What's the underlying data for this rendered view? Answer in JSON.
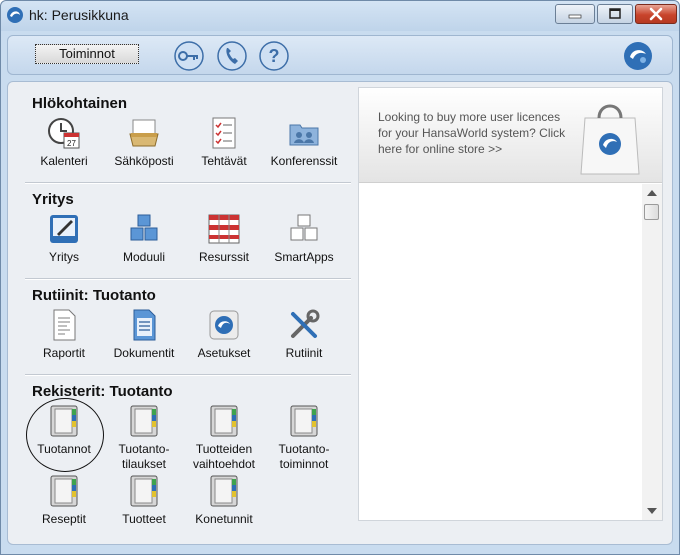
{
  "window": {
    "title": "hk: Perusikkuna"
  },
  "toolbar": {
    "menu_button_label": "Toiminnot",
    "icons": [
      "key-icon",
      "phone-icon",
      "help-icon",
      "globe-icon"
    ]
  },
  "sections": [
    {
      "title": "Hlökohtainen",
      "items": [
        "Kalenteri",
        "Sähköposti",
        "Tehtävät",
        "Konferenssit"
      ]
    },
    {
      "title": "Yritys",
      "items": [
        "Yritys",
        "Moduuli",
        "Resurssit",
        "SmartApps"
      ]
    },
    {
      "title": "Rutiinit: Tuotanto",
      "items": [
        "Raportit",
        "Dokumentit",
        "Asetukset",
        "Rutiinit"
      ]
    },
    {
      "title": "Rekisterit: Tuotanto",
      "items": [
        "Tuotannot",
        "Tuotanto-\ntilaukset",
        "Tuotteiden\nvaihtoehdot",
        "Tuotanto-\ntoiminnot",
        "Reseptit",
        "Tuotteet",
        "Konetunnit"
      ]
    }
  ],
  "ad": {
    "text": "Looking to buy more user licences for your HansaWorld system? Click here for online store >>"
  },
  "colors": {
    "title_bar": "#c9dcef",
    "close_button": "#c8442c",
    "panel": "#eceff3",
    "accent_blue": "#2f6fb6"
  }
}
